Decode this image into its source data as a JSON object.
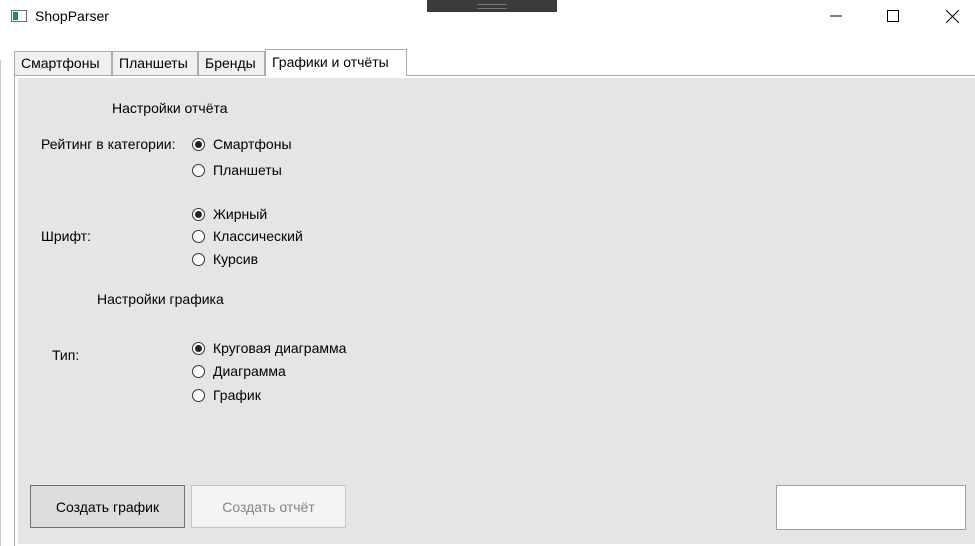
{
  "window": {
    "title": "ShopParser"
  },
  "tabs": [
    {
      "label": "Смартфоны",
      "active": false
    },
    {
      "label": "Планшеты",
      "active": false
    },
    {
      "label": "Бренды",
      "active": false
    },
    {
      "label": "Графики и отчёты",
      "active": true
    }
  ],
  "report_settings": {
    "heading": "Настройки отчёта",
    "category_label": "Рейтинг в категории:",
    "category_options": [
      {
        "label": "Смартфоны",
        "checked": true
      },
      {
        "label": "Планшеты",
        "checked": false
      }
    ],
    "font_label": "Шрифт:",
    "font_options": [
      {
        "label": "Жирный",
        "checked": true
      },
      {
        "label": "Классический",
        "checked": false
      },
      {
        "label": "Курсив",
        "checked": false
      }
    ]
  },
  "chart_settings": {
    "heading": "Настройки графика",
    "type_label": "Тип:",
    "type_options": [
      {
        "label": "Круговая диаграмма",
        "checked": true
      },
      {
        "label": "Диаграмма",
        "checked": false
      },
      {
        "label": "График",
        "checked": false
      }
    ]
  },
  "buttons": {
    "create_chart": "Создать график",
    "create_report": "Создать отчёт",
    "create_report_enabled": false
  },
  "output_box": {
    "value": ""
  },
  "icons": {
    "app": "app-window-icon",
    "minimize": "minimize-icon",
    "maximize": "maximize-icon",
    "close": "close-icon"
  }
}
